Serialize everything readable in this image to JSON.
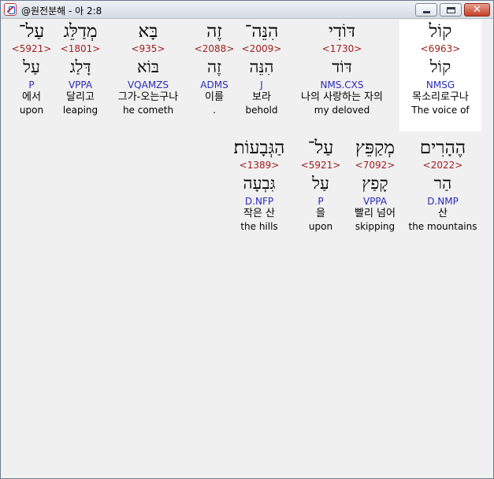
{
  "window": {
    "title": "@원전분해 - 아 2:8",
    "minimize_glyph": "",
    "maximize_glyph": "",
    "close_glyph": "✕"
  },
  "rows": [
    {
      "words": [
        {
          "hebrew": "קוֹל",
          "strong": "<6963>",
          "root": "קוֹל",
          "parse": "NMSG",
          "korean": "목소리로구나",
          "english": "The voice of",
          "selected": true
        },
        {
          "hebrew": "דּוֹדִי",
          "strong": "<1730>",
          "root": "דּוֹד",
          "parse": "NMS.CXS",
          "korean": "나의 사랑하는 자의",
          "english": "my deloved",
          "selected": false
        },
        {
          "hebrew": "הִנֵּה־",
          "strong": "<2009>",
          "root": "הִנֵּה",
          "parse": "J",
          "korean": "보라",
          "english": "behold",
          "selected": false
        },
        {
          "hebrew": "זֶה",
          "strong": "<2088>",
          "root": "זֶה",
          "parse": "ADMS",
          "korean": "이를",
          "english": ".",
          "selected": false
        },
        {
          "hebrew": "בָּא",
          "strong": "<935>",
          "root": "בּוֹא",
          "parse": "VQAMZS",
          "korean": "그가-오는구나",
          "english": "he cometh",
          "selected": false
        },
        {
          "hebrew": "מְדַלֵּג",
          "strong": "<1801>",
          "root": "דָּלַג",
          "parse": "VPPA",
          "korean": "달리고",
          "english": "leaping",
          "selected": false
        },
        {
          "hebrew": "עַל־",
          "strong": "<5921>",
          "root": "עַל",
          "parse": "P",
          "korean": "에서",
          "english": "upon",
          "selected": false
        }
      ]
    },
    {
      "words": [
        {
          "hebrew": "הֶהָרִים",
          "strong": "<2022>",
          "root": "הַר",
          "parse": "D.NMP",
          "korean": "산",
          "english": "the mountains",
          "selected": false
        },
        {
          "hebrew": "מְקַפֵּץ",
          "strong": "<7092>",
          "root": "קָפַץ",
          "parse": "VPPA",
          "korean": "빨리 넘어",
          "english": "skipping",
          "selected": false
        },
        {
          "hebrew": "עַל־",
          "strong": "<5921>",
          "root": "עַל",
          "parse": "P",
          "korean": "을",
          "english": "upon",
          "selected": false
        },
        {
          "hebrew": "הַגְּבָעוֹת׃",
          "strong": "<1389>",
          "root": "גִּבְעָה",
          "parse": "D.NFP",
          "korean": "작은 산",
          "english": "the hills",
          "selected": false
        }
      ]
    }
  ]
}
